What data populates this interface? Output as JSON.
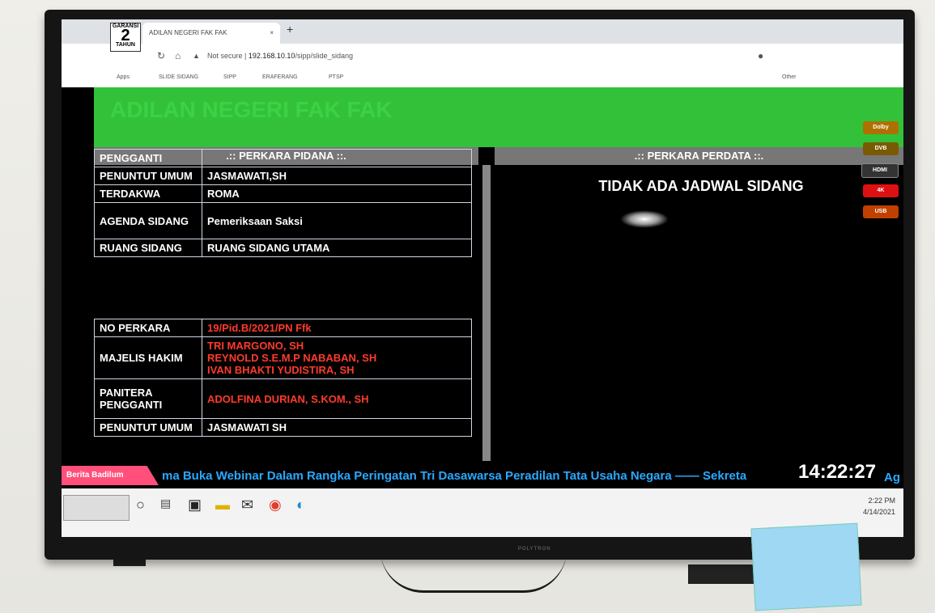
{
  "browser": {
    "logo_top": "GARANSI",
    "logo_number": "2",
    "logo_bottom": "TAHUN",
    "tab_title": "ADILAN NEGERI FAK FAK",
    "tab_close": "×",
    "new_tab": "+",
    "not_secure": "Not secure",
    "url_host": "192.168.10.10",
    "url_path": "/sipp/slide_sidang",
    "bookmarks": [
      "Apps",
      "SLIDE SIDANG",
      "SIPP",
      "ERAFERANG",
      "PTSP"
    ],
    "other_bookmarks": "Other"
  },
  "page": {
    "banner_title": "ADILAN NEGERI FAK FAK",
    "pidana_header": ".:: PERKARA PIDANA ::.",
    "perdata_header": ".:: PERKARA PERDATA ::.",
    "no_schedule": "TIDAK ADA JADWAL SIDANG",
    "case1": [
      {
        "label": "PENGGANTI",
        "value": ""
      },
      {
        "label": "PENUNTUT UMUM",
        "value": "JASMAWATI,SH"
      },
      {
        "label": "TERDAKWA",
        "value": "ROMA"
      },
      {
        "label": "AGENDA SIDANG",
        "value": "Pemeriksaan Saksi"
      },
      {
        "label": "RUANG SIDANG",
        "value": "RUANG SIDANG UTAMA"
      }
    ],
    "case2": {
      "no_perkara_label": "NO PERKARA",
      "no_perkara": "19/Pid.B/2021/PN Ffk",
      "majelis_label": "MAJELIS HAKIM",
      "majelis": [
        "TRI MARGONO, SH",
        "REYNOLD S.E.M.P NABABAN, SH",
        "IVAN BHAKTI YUDISTIRA, SH"
      ],
      "panitera_label": "PANITERA PENGGANTI",
      "panitera": "ADOLFINA DURIAN, S.KOM., SH",
      "penuntut_label": "PENUNTUT UMUM",
      "penuntut": "JASMAWATI SH"
    },
    "ticker_label": "Berita Badilum",
    "ticker_text": "ma Buka Webinar Dalam Rangka Peringatan Tri Dasawarsa Peradilan Tata Usaha Negara —— Sekreta",
    "ticker_tail": "Ag",
    "clock": "14:22:27"
  },
  "taskbar": {
    "time": "2:22 PM",
    "date": "4/14/2021"
  },
  "tv": {
    "brand": "POLYTRON",
    "stickers": [
      "Dolby",
      "DVB",
      "HDMI",
      "4K",
      "USB"
    ]
  },
  "colors": {
    "banner": "#33c13a",
    "accent_red": "#ff3b2b",
    "ticker_blue": "#29a9ff",
    "ticker_label": "#ff4f7a"
  }
}
